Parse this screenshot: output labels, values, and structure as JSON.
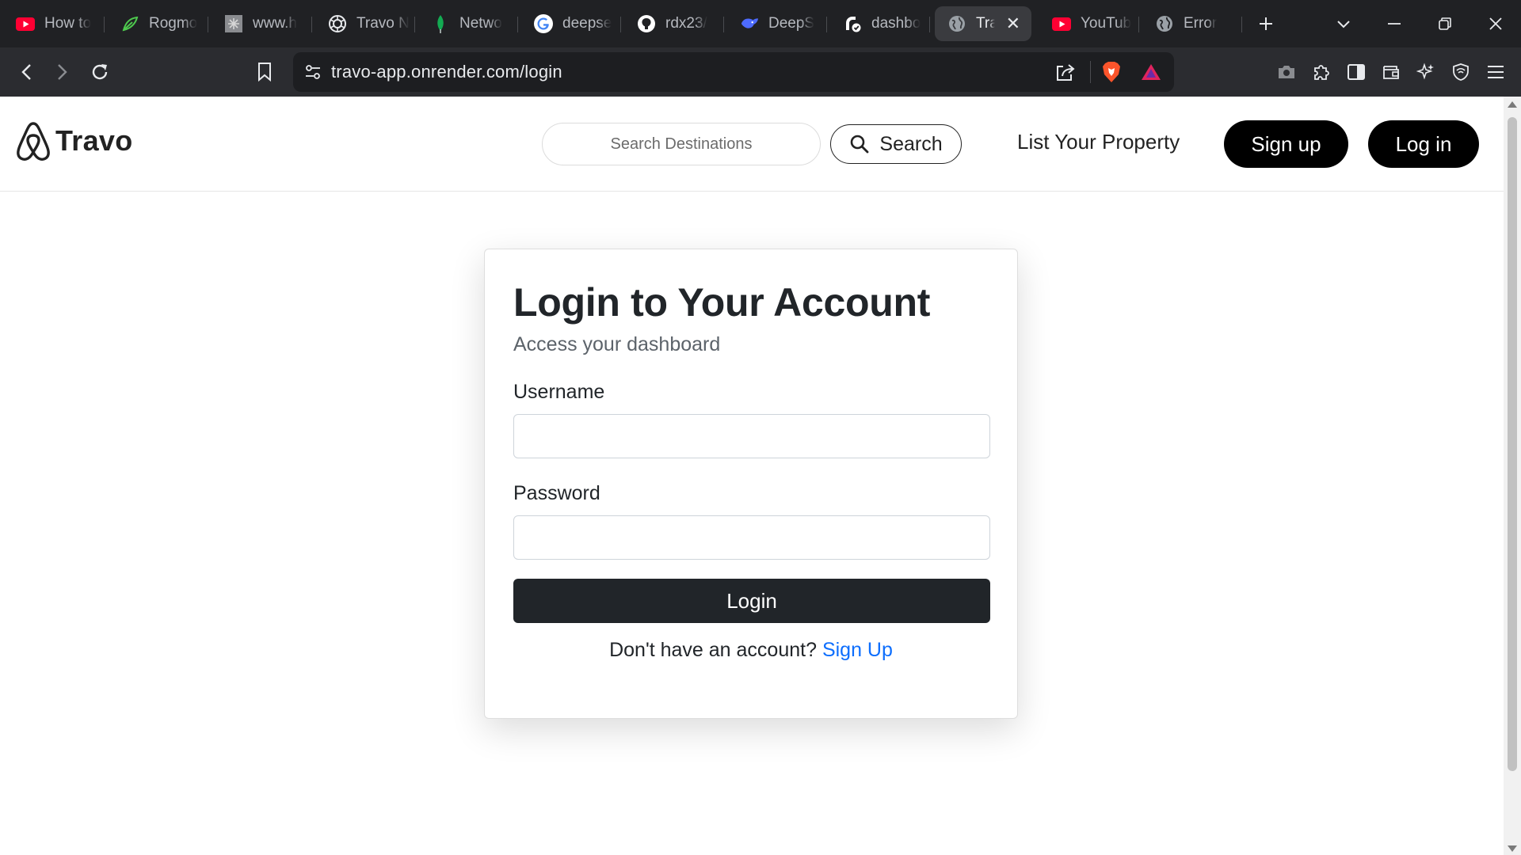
{
  "browser": {
    "tabs": [
      {
        "title": "How to",
        "icon": "youtube-icon"
      },
      {
        "title": "Rogmo",
        "icon": "leaf-icon"
      },
      {
        "title": "www.h",
        "icon": "image-icon"
      },
      {
        "title": "Travo N",
        "icon": "openai-icon"
      },
      {
        "title": "Netwo",
        "icon": "mongodb-icon"
      },
      {
        "title": "deepse",
        "icon": "google-icon"
      },
      {
        "title": "rdx23/",
        "icon": "github-icon"
      },
      {
        "title": "DeepS",
        "icon": "deepseek-icon"
      },
      {
        "title": "dashbo",
        "icon": "render-icon"
      },
      {
        "title": "Tra",
        "icon": "globe-icon",
        "active": true
      },
      {
        "title": "YouTub",
        "icon": "youtube-icon"
      },
      {
        "title": "Error",
        "icon": "globe-icon"
      }
    ],
    "url": "travo-app.onrender.com/login"
  },
  "navbar": {
    "brand": "Travo",
    "search_placeholder": "Search Destinations",
    "search_button": "Search",
    "list_property": "List Your Property",
    "signup": "Sign up",
    "login": "Log in"
  },
  "login_card": {
    "title": "Login to Your Account",
    "subtitle": "Access your dashboard",
    "username_label": "Username",
    "username_value": "",
    "password_label": "Password",
    "password_value": "",
    "submit": "Login",
    "footer_text": "Don't have an account?",
    "footer_link": "Sign Up"
  },
  "colors": {
    "chrome_bg": "#202124",
    "toolbar_bg": "#2b2c30",
    "primary_dark": "#212529",
    "link_blue": "#0d6efd",
    "pill_black": "#000000"
  }
}
